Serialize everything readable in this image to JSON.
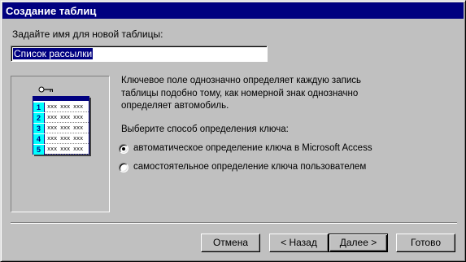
{
  "window": {
    "title": "Создание таблиц",
    "controls": {
      "help": "?",
      "close": "×"
    }
  },
  "prompt": {
    "label": "Задайте имя для новой таблицы:",
    "value": "Список рассылки"
  },
  "illustration": {
    "rows": [
      {
        "num": "1",
        "cells": "xxx xxx xxx"
      },
      {
        "num": "2",
        "cells": "xxx xxx xxx"
      },
      {
        "num": "3",
        "cells": "xxx xxx xxx"
      },
      {
        "num": "4",
        "cells": "xxx xxx xxx"
      },
      {
        "num": "5",
        "cells": "xxx xxx xxx"
      }
    ]
  },
  "description": {
    "line1": "Ключевое поле однозначно определяет каждую запись",
    "line2": "таблицы подобно тому, как номерной знак однозначно",
    "line3": "определяет автомобиль."
  },
  "key_choice": {
    "label": "Выберите способ определения ключа:",
    "options": [
      {
        "label": "автоматическое определение ключа в Microsoft Access",
        "selected": true
      },
      {
        "label": "самостоятельное определение ключа пользователем",
        "selected": false
      }
    ]
  },
  "buttons": {
    "cancel": "Отмена",
    "back": "< Назад",
    "next": "Далее >",
    "finish": "Готово"
  }
}
